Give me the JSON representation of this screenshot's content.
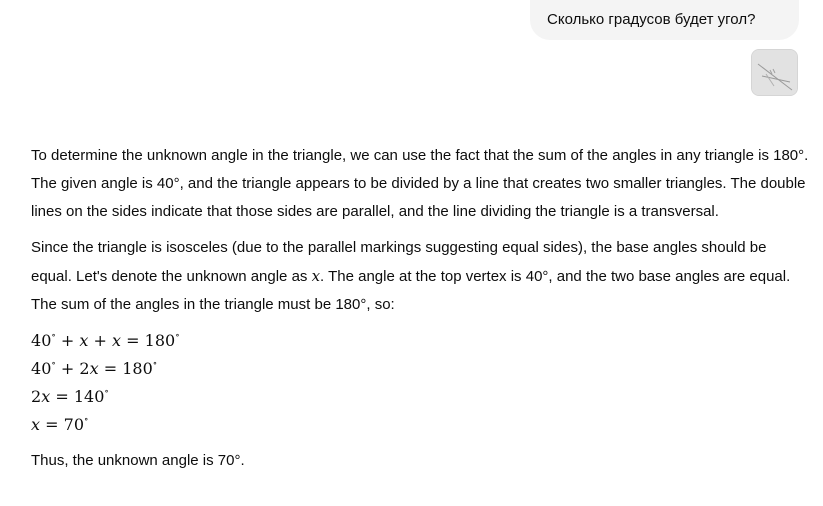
{
  "user_message": {
    "text": "Сколько градусов будет угол?",
    "attachment_icon": "triangle-photo-thumbnail"
  },
  "assistant_message": {
    "paragraph1": "To determine the unknown angle in the triangle, we can use the fact that the sum of the angles in any triangle is 180°. The given angle is 40°, and the triangle appears to be divided by a line that creates two smaller triangles. The double lines on the sides indicate that those sides are parallel, and the line dividing the triangle is a transversal.",
    "paragraph2_before_var": "Since the triangle is isosceles (due to the parallel markings suggesting equal sides), the base angles should be equal. Let's denote the unknown angle as ",
    "paragraph2_var": "x",
    "paragraph2_after_var": ". The angle at the top vertex is 40°, and the two base angles are equal. The sum of the angles in the triangle must be 180°, so:",
    "equations": [
      {
        "lhs": "40",
        "deg1": "∘",
        "rest": " + x + x = 180",
        "deg2": "∘"
      },
      {
        "lhs": "40",
        "deg1": "∘",
        "rest": " + 2x = 180",
        "deg2": "∘"
      },
      {
        "lhs": "2x = 140",
        "deg1": "∘",
        "rest": "",
        "deg2": ""
      },
      {
        "lhs": "x = 70",
        "deg1": "∘",
        "rest": "",
        "deg2": ""
      }
    ],
    "conclusion": "Thus, the unknown angle is 70°."
  }
}
